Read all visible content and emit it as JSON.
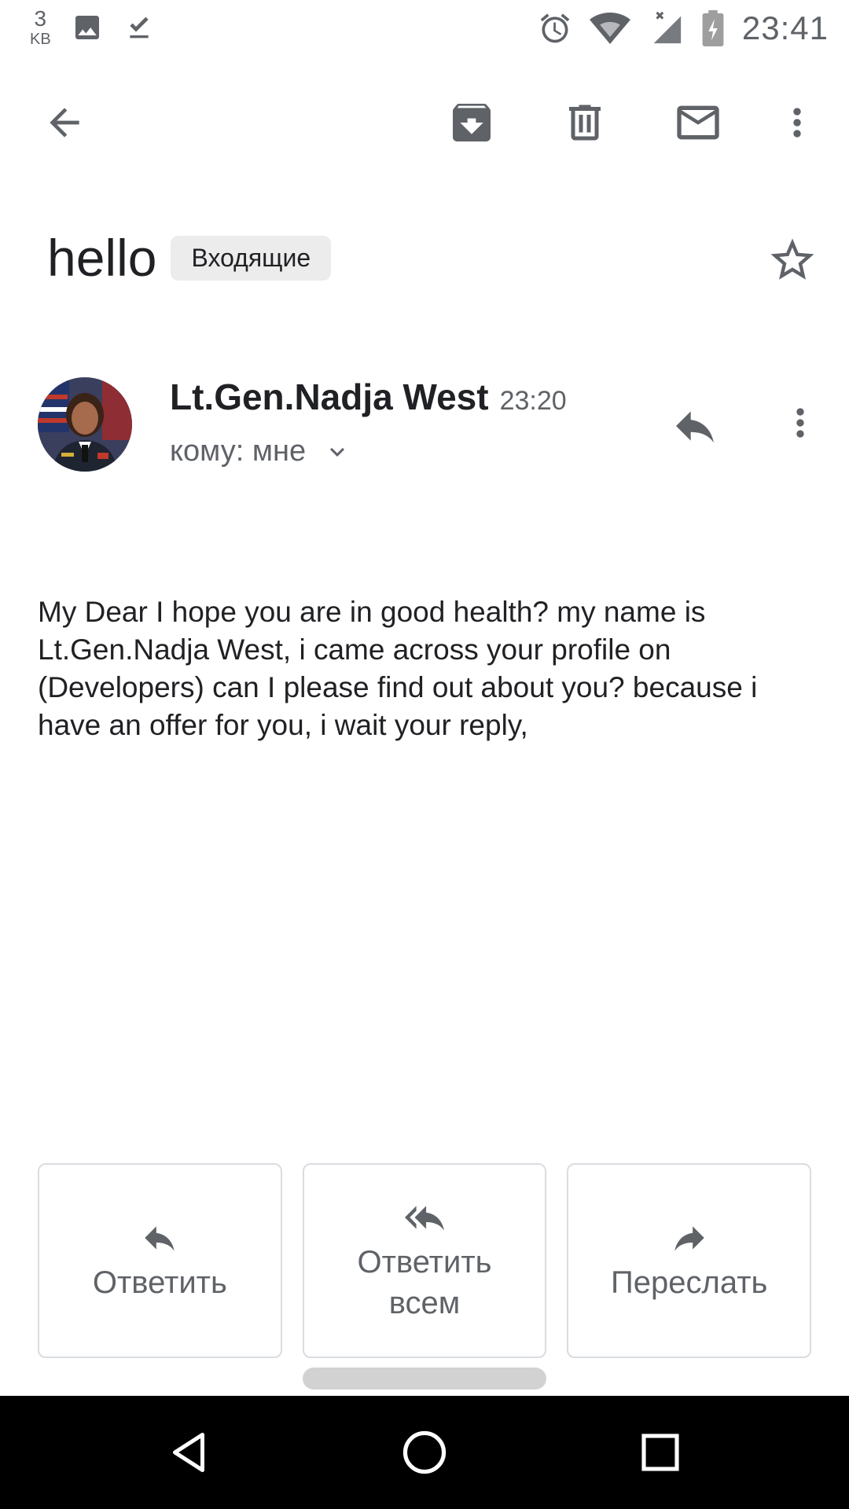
{
  "status_bar": {
    "data_amount": "3",
    "data_unit": "KB",
    "time": "23:41"
  },
  "toolbar": {
    "back_icon": "arrow-back-icon",
    "archive_icon": "archive-icon",
    "delete_icon": "trash-icon",
    "mark_unread_icon": "mail-icon",
    "more_icon": "more-vert-icon"
  },
  "email": {
    "subject": "hello",
    "label": "Входящие",
    "sender_name": "Lt.Gen.Nadja West",
    "sent_time": "23:20",
    "recipient": "кому: мне",
    "body": "My Dear I hope you are in good health? my name is Lt.Gen.Nadja West, i came across your profile on (Developers) can I please find out about you? because i have an offer for you, i wait your reply,"
  },
  "actions": {
    "reply": "Ответить",
    "reply_all": "Ответить всем",
    "forward": "Переслать"
  },
  "colors": {
    "text_primary": "#202124",
    "text_secondary": "#5f6368",
    "chip_bg": "#ececec",
    "border": "#dadce0",
    "navbar_bg": "#000000"
  }
}
